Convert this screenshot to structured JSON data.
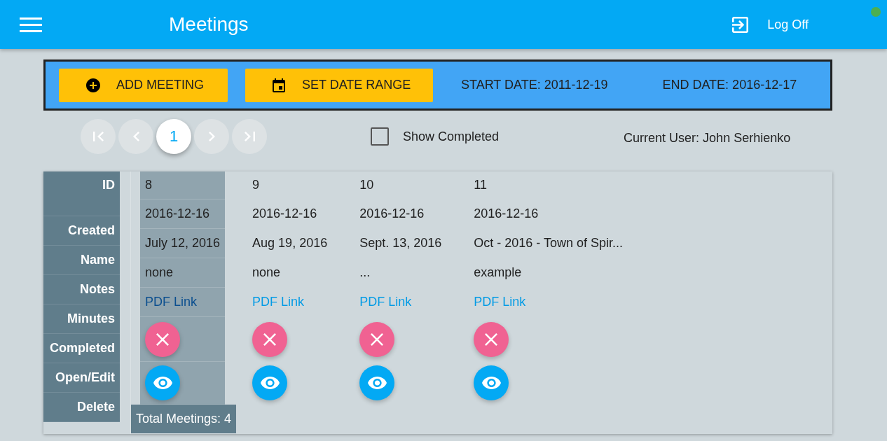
{
  "app_bar": {
    "title": "Meetings",
    "log_off": "Log Off"
  },
  "toolbar": {
    "buttons": [
      {
        "kind": "add",
        "label": "ADD MEETING"
      },
      {
        "kind": "date",
        "label": "SET DATE RANGE"
      }
    ],
    "start_date": "START DATE: 2011-12-19",
    "end_date": "END DATE: 2016-12-17"
  },
  "pagination": [
    {
      "kind": "first",
      "disabled": true
    },
    {
      "kind": "prev",
      "disabled": true
    },
    {
      "kind": "page",
      "label": "1",
      "selected": true
    },
    {
      "kind": "next",
      "disabled": true
    },
    {
      "kind": "last",
      "disabled": true
    }
  ],
  "show_completed": {
    "label": "Show Completed",
    "checked": false
  },
  "current_user": "Current User: John Serhienko",
  "table": {
    "row_labels": [
      "ID",
      "Created",
      "Name",
      "Notes",
      "Minutes",
      "Completed",
      "Open/Edit",
      "Delete"
    ],
    "meetings": [
      {
        "id": "8",
        "created": "2016-12-16",
        "name": "July 12, 2016",
        "notes": "none",
        "minutes": "PDF Link",
        "completed": false,
        "selected": true
      },
      {
        "id": "9",
        "created": "2016-12-16",
        "name": "Aug 19, 2016",
        "notes": "none",
        "minutes": "PDF Link",
        "completed": false,
        "selected": false
      },
      {
        "id": "10",
        "created": "2016-12-16",
        "name": "Sept. 13, 2016",
        "notes": "...",
        "minutes": "PDF Link",
        "completed": false,
        "selected": false
      },
      {
        "id": "11",
        "created": "2016-12-16",
        "name": "Oct - 2016 - Town of Spir...",
        "notes": "example",
        "minutes": "PDF Link",
        "completed": false,
        "selected": false
      }
    ],
    "total": "Total Meetings: 4"
  }
}
